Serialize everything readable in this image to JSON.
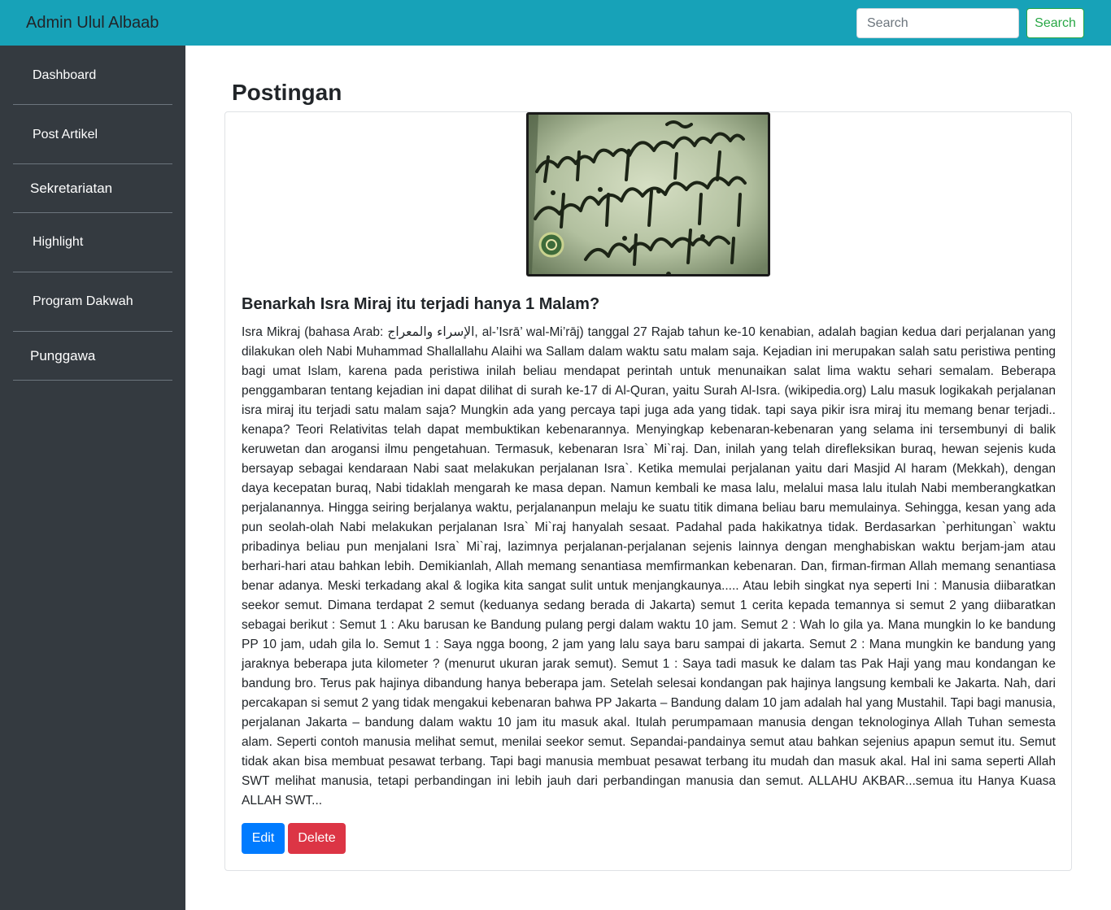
{
  "navbar": {
    "brand": "Admin Ulul Albaab",
    "search_placeholder": "Search",
    "search_button": "Search"
  },
  "sidebar": {
    "items": [
      {
        "label": "Dashboard"
      },
      {
        "label": "Post Artikel"
      },
      {
        "label": "Sekretariatan"
      },
      {
        "label": "Highlight"
      },
      {
        "label": "Program Dakwah"
      },
      {
        "label": "Punggawa"
      }
    ]
  },
  "main": {
    "title": "Postingan",
    "post": {
      "image_alt": "Quran verse Al-Isra",
      "heading": "Benarkah Isra Miraj itu terjadi hanya 1 Malam?",
      "body": "Isra Mikraj (bahasa Arab: الإسراء والمعراج, al-’Isrā’ wal-Mi’rāj) tanggal 27 Rajab tahun ke-10 kenabian, adalah bagian kedua dari perjalanan yang dilakukan oleh Nabi Muhammad Shallallahu Alaihi wa Sallam dalam waktu satu malam saja. Kejadian ini merupakan salah satu peristiwa penting bagi umat Islam, karena pada peristiwa inilah beliau mendapat perintah untuk menunaikan salat lima waktu sehari semalam. Beberapa penggambaran tentang kejadian ini dapat dilihat di surah ke-17 di Al-Quran, yaitu Surah Al-Isra. (wikipedia.org) Lalu masuk logikakah perjalanan isra miraj itu terjadi satu malam saja? Mungkin ada yang percaya tapi juga ada yang tidak. tapi saya pikir isra miraj itu memang benar terjadi.. kenapa? Teori Relativitas telah dapat membuktikan kebenarannya. Menyingkap kebenaran-kebenaran yang selama ini tersembunyi di balik keruwetan dan arogansi ilmu pengetahuan. Termasuk, kebenaran Isra` Mi`raj. Dan, inilah yang telah direfleksikan buraq, hewan sejenis kuda bersayap sebagai kendaraan Nabi saat melakukan perjalanan Isra`. Ketika memulai perjalanan yaitu dari Masjid Al haram (Mekkah), dengan daya kecepatan buraq, Nabi tidaklah mengarah ke masa depan. Namun kembali ke masa lalu, melalui masa lalu itulah Nabi memberangkatkan perjalanannya. Hingga seiring berjalanya waktu, perjalananpun melaju ke suatu titik dimana beliau baru memulainya. Sehingga, kesan yang ada pun seolah-olah Nabi melakukan perjalanan Isra` Mi`raj hanyalah sesaat. Padahal pada hakikatnya tidak. Berdasarkan `perhitungan` waktu pribadinya beliau pun menjalani Isra` Mi`raj, lazimnya perjalanan-perjalanan sejenis lainnya dengan menghabiskan waktu berjam-jam atau berhari-hari atau bahkan lebih. Demikianlah, Allah memang senantiasa memfirmankan kebenaran. Dan, firman-firman Allah memang senantiasa benar adanya. Meski terkadang akal & logika kita sangat sulit untuk menjangkaunya..... Atau lebih singkat nya seperti Ini : Manusia diibaratkan seekor semut. Dimana terdapat 2 semut (keduanya sedang berada di Jakarta) semut 1 cerita kepada temannya si semut 2 yang diibaratkan sebagai berikut : Semut 1 : Aku barusan ke Bandung pulang pergi dalam waktu 10 jam. Semut 2 : Wah lo gila ya. Mana mungkin lo ke bandung PP 10 jam, udah gila lo. Semut 1 : Saya ngga boong, 2 jam yang lalu saya baru sampai di jakarta. Semut 2 : Mana mungkin ke bandung yang jaraknya beberapa juta kilometer ? (menurut ukuran jarak semut). Semut 1 : Saya tadi masuk ke dalam tas Pak Haji yang mau kondangan ke bandung bro. Terus pak hajinya dibandung hanya beberapa jam. Setelah selesai kondangan pak hajinya langsung kembali ke Jakarta. Nah, dari percakapan si semut 2 yang tidak mengakui kebenaran bahwa PP Jakarta – Bandung dalam 10 jam adalah hal yang Mustahil. Tapi bagi manusia, perjalanan Jakarta – bandung dalam waktu 10 jam itu masuk akal. Itulah perumpamaan manusia dengan teknologinya Allah Tuhan semesta alam. Seperti contoh manusia melihat semut, menilai seekor semut. Sepandai-pandainya semut atau bahkan sejenius apapun semut itu. Semut tidak akan bisa membuat pesawat terbang. Tapi bagi manusia membuat pesawat terbang itu mudah dan masuk akal. Hal ini sama seperti Allah SWT melihat manusia, tetapi perbandingan ini lebih jauh dari perbandingan manusia dan semut. ALLAHU AKBAR...semua itu Hanya Kuasa ALLAH SWT...",
      "edit_label": "Edit",
      "delete_label": "Delete"
    }
  },
  "colors": {
    "navbar": "#17a2b8",
    "sidebar": "#343a40",
    "edit": "#007bff",
    "delete": "#dc3545",
    "search_outline": "#28a745"
  }
}
